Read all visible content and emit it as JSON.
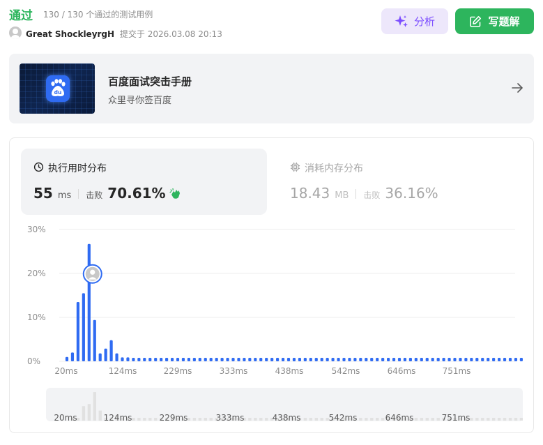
{
  "submission": {
    "status": "通过",
    "cases": "130 / 130 个通过的测试用例",
    "username": "Great ShockleyrgH",
    "submitted_at": "提交于 2026.03.08 20:13"
  },
  "buttons": {
    "analyze": "分析",
    "solution": "写题解"
  },
  "banner": {
    "title": "百度面试突击手册",
    "subtitle": "众里寻你签百度"
  },
  "runtime": {
    "heading": "执行用时分布",
    "value": "55",
    "unit": "ms",
    "beat_label": "击败",
    "beat_percent": "70.61%"
  },
  "memory": {
    "heading": "消耗内存分布",
    "value": "18.43",
    "unit": "MB",
    "beat_label": "击败",
    "beat_percent": "36.16%"
  },
  "colors": {
    "accepted": "#2db55d",
    "bar": "#2f6bf2",
    "analyze_bg": "#ede7fb",
    "analyze_fg": "#7c4dff"
  },
  "icons": {
    "analyze": "sparkle-icon",
    "solution": "edit-icon",
    "banner_arrow": "arrow-right-icon",
    "runtime": "clock-icon",
    "memory": "chip-icon",
    "beat": "clap-icon"
  },
  "chart_data": {
    "type": "bar",
    "ylabel": "",
    "xlabel": "",
    "y_ticks": [
      "30%",
      "20%",
      "10%",
      "0%"
    ],
    "ylim": [
      0,
      30
    ],
    "x_tick_labels": [
      "20ms",
      "124ms",
      "229ms",
      "333ms",
      "438ms",
      "542ms",
      "646ms",
      "751ms"
    ],
    "highlight_bar_index": 5,
    "values": [
      1,
      2,
      13.5,
      15.5,
      26.7,
      9.4,
      1.8,
      2.9,
      4.8,
      1.8,
      0.9,
      0.9,
      0.8,
      0.8,
      0.8,
      0.8,
      0.8,
      0.8,
      0.8,
      0.8,
      0.8,
      0.8,
      0.8,
      0.8,
      0.8,
      0.8,
      0.8,
      0.8,
      0.8,
      0.8,
      0.8,
      0.8,
      0.8,
      0.8,
      0.8,
      0.8,
      0.8,
      0.8,
      0.8,
      0.8,
      0.8,
      0.8,
      0.8,
      0.8,
      0.8,
      0.8,
      0.8,
      0.8,
      0.8,
      0.8,
      0.8,
      0.8,
      0.8,
      0.8,
      0.8,
      0.8,
      0.8,
      0.8,
      0.8,
      0.8,
      0.8,
      0.8,
      0.8,
      0.8,
      0.8,
      0.8,
      0.8,
      0.8,
      0.8,
      0.8,
      0.8,
      0.8,
      0.8,
      0.8,
      0.8,
      0.8,
      0.8,
      0.8,
      0.8,
      0.8,
      0.8,
      0.8,
      0.8,
      0.8,
      0.8
    ],
    "grid": true
  }
}
